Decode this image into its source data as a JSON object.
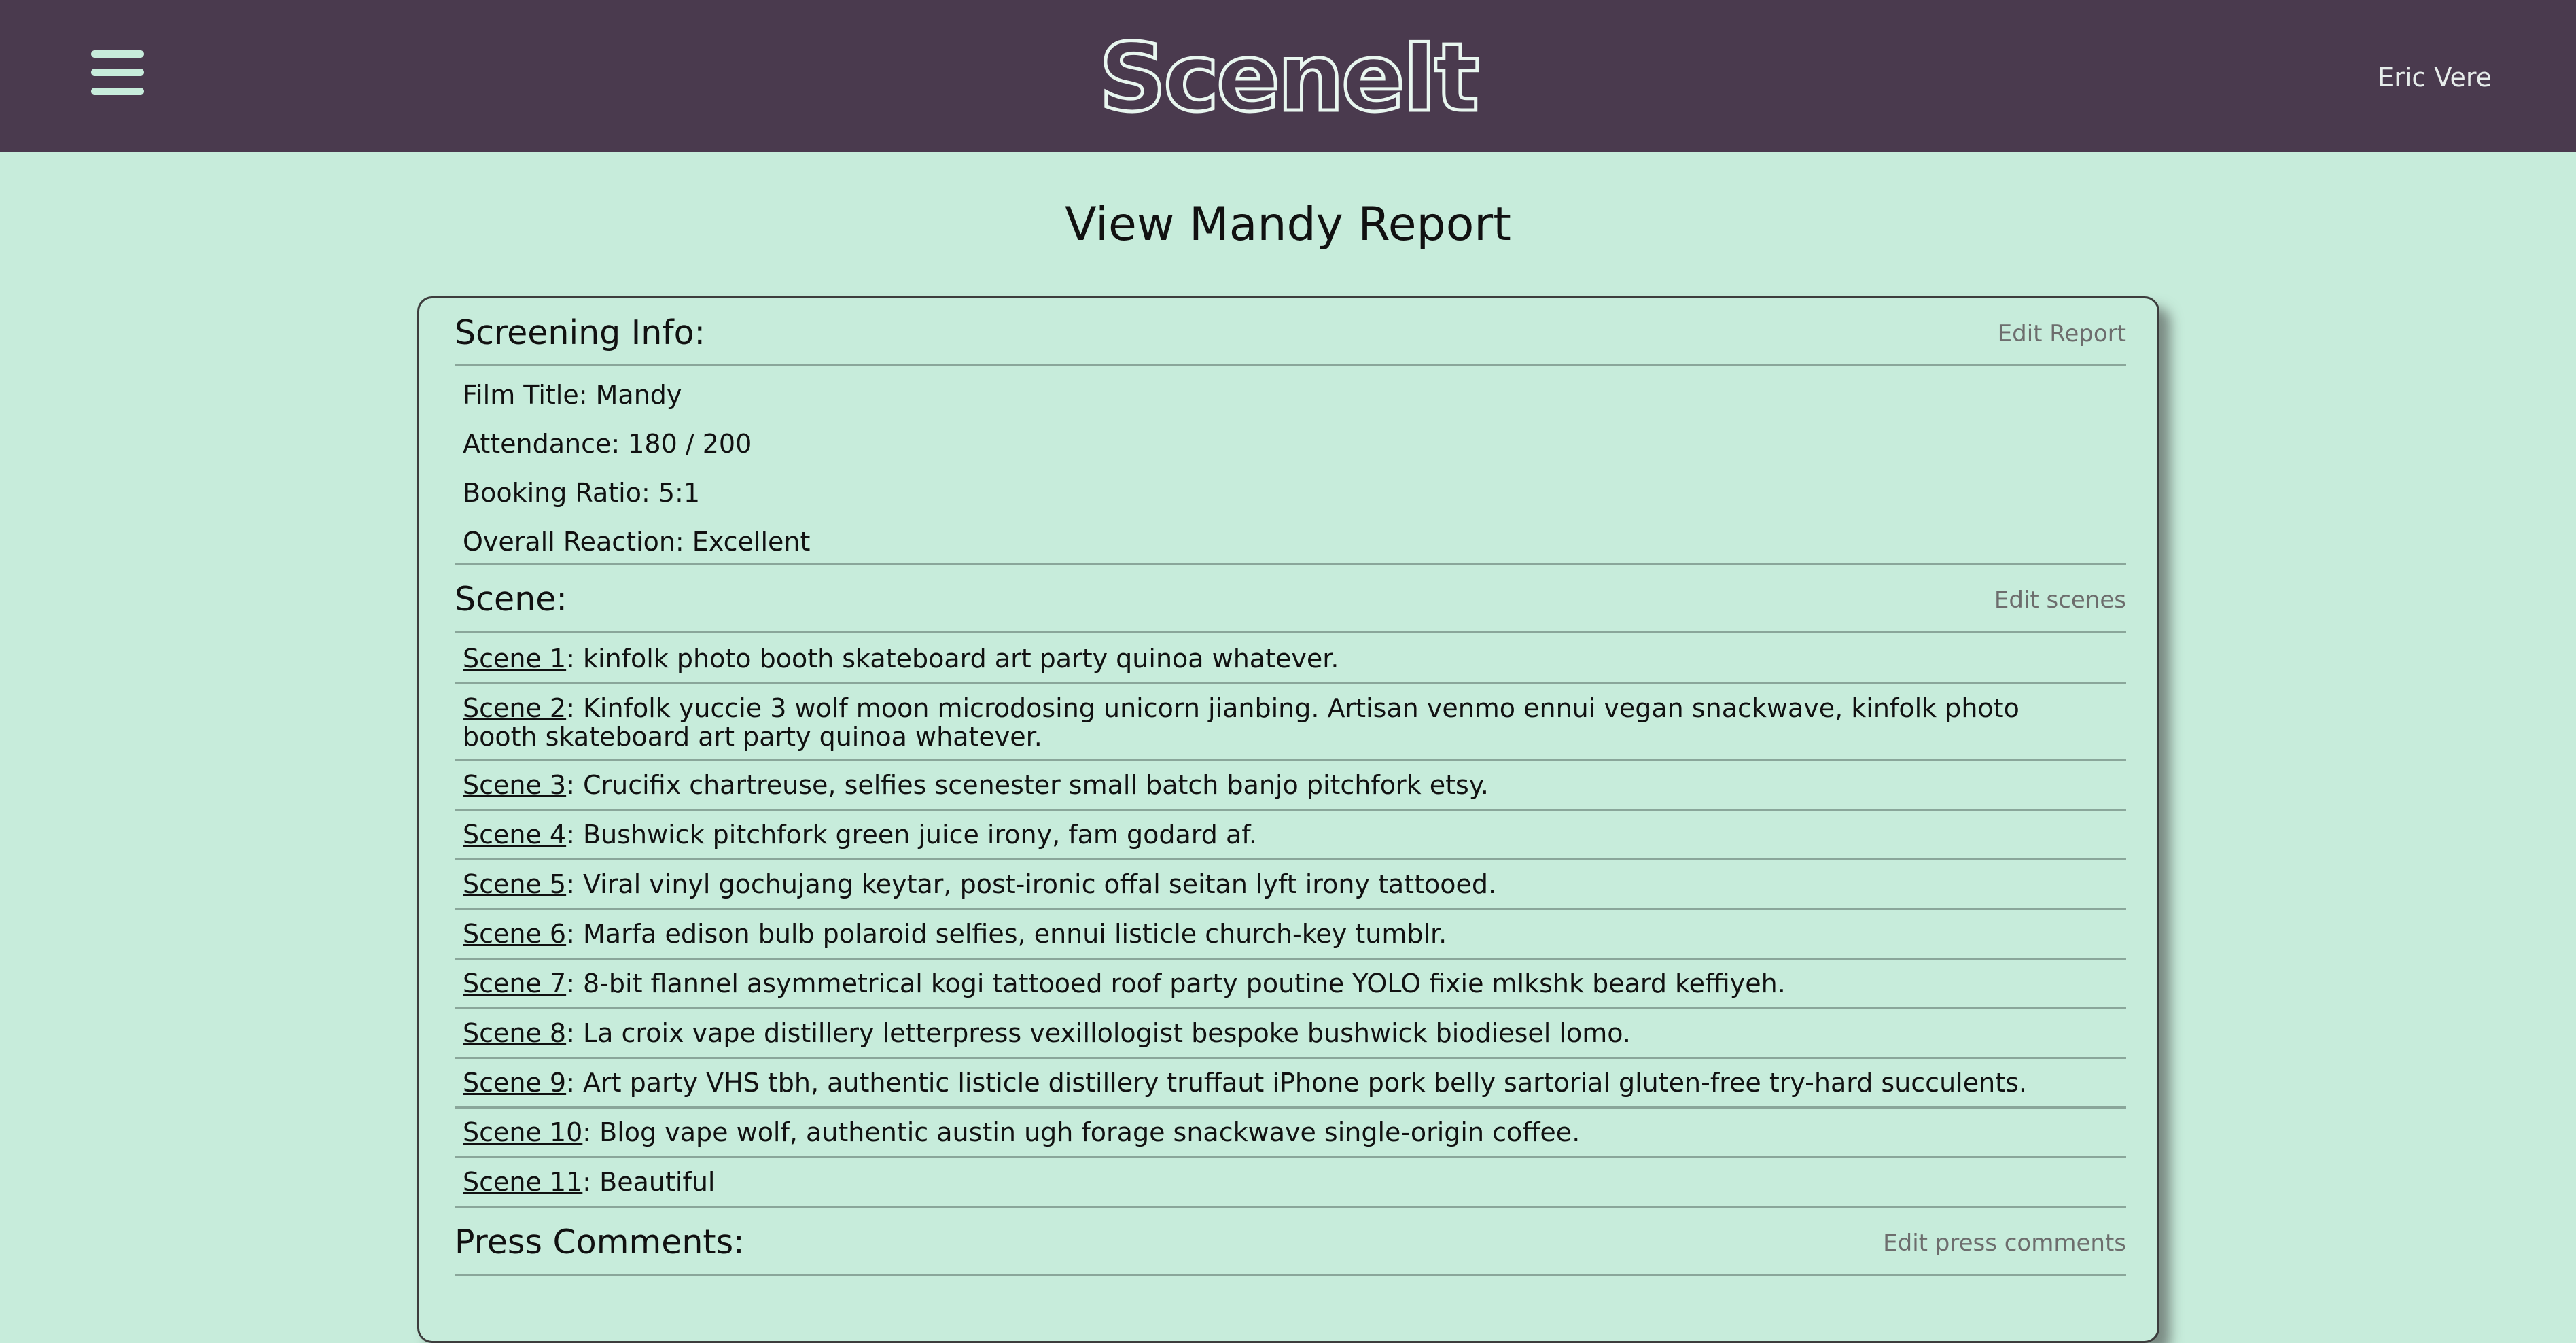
{
  "header": {
    "logo": "SceneIt",
    "user_name": "Eric Vere"
  },
  "page": {
    "title": "View Mandy Report"
  },
  "screening_info": {
    "title": "Screening Info:",
    "edit_label": "Edit Report",
    "film_title": "Film Title: Mandy",
    "attendance": "Attendance: 180 / 200",
    "booking_ratio": "Booking Ratio: 5:1",
    "overall_reaction": "Overall Reaction: Excellent"
  },
  "scenes": {
    "title": "Scene:",
    "edit_label": "Edit scenes",
    "items": [
      {
        "link": "Scene 1",
        "text": ": kinfolk photo booth skateboard art party quinoa whatever."
      },
      {
        "link": "Scene 2",
        "text": ": Kinfolk yuccie 3 wolf moon microdosing unicorn jianbing. Artisan venmo ennui vegan snackwave, kinfolk photo booth skateboard art party quinoa whatever."
      },
      {
        "link": "Scene 3",
        "text": ": Crucifix chartreuse, selfies scenester small batch banjo pitchfork etsy."
      },
      {
        "link": "Scene 4",
        "text": ": Bushwick pitchfork green juice irony, fam godard af."
      },
      {
        "link": "Scene 5",
        "text": ": Viral vinyl gochujang keytar, post-ironic offal seitan lyft irony tattooed."
      },
      {
        "link": "Scene 6",
        "text": ": Marfa edison bulb polaroid selfies, ennui listicle church-key tumblr."
      },
      {
        "link": "Scene 7",
        "text": ": 8-bit flannel asymmetrical kogi tattooed roof party poutine YOLO fixie mlkshk beard keffiyeh."
      },
      {
        "link": "Scene 8",
        "text": ": La croix vape distillery letterpress vexillologist bespoke bushwick biodiesel lomo."
      },
      {
        "link": "Scene 9",
        "text": ": Art party VHS tbh, authentic listicle distillery truffaut iPhone pork belly sartorial gluten-free try-hard succulents."
      },
      {
        "link": "Scene 10",
        "text": ": Blog vape wolf, authentic austin ugh forage snackwave single-origin coffee."
      },
      {
        "link": "Scene 11",
        "text": ": Beautiful"
      }
    ]
  },
  "press_comments": {
    "title": "Press Comments:",
    "edit_label": "Edit press comments"
  }
}
